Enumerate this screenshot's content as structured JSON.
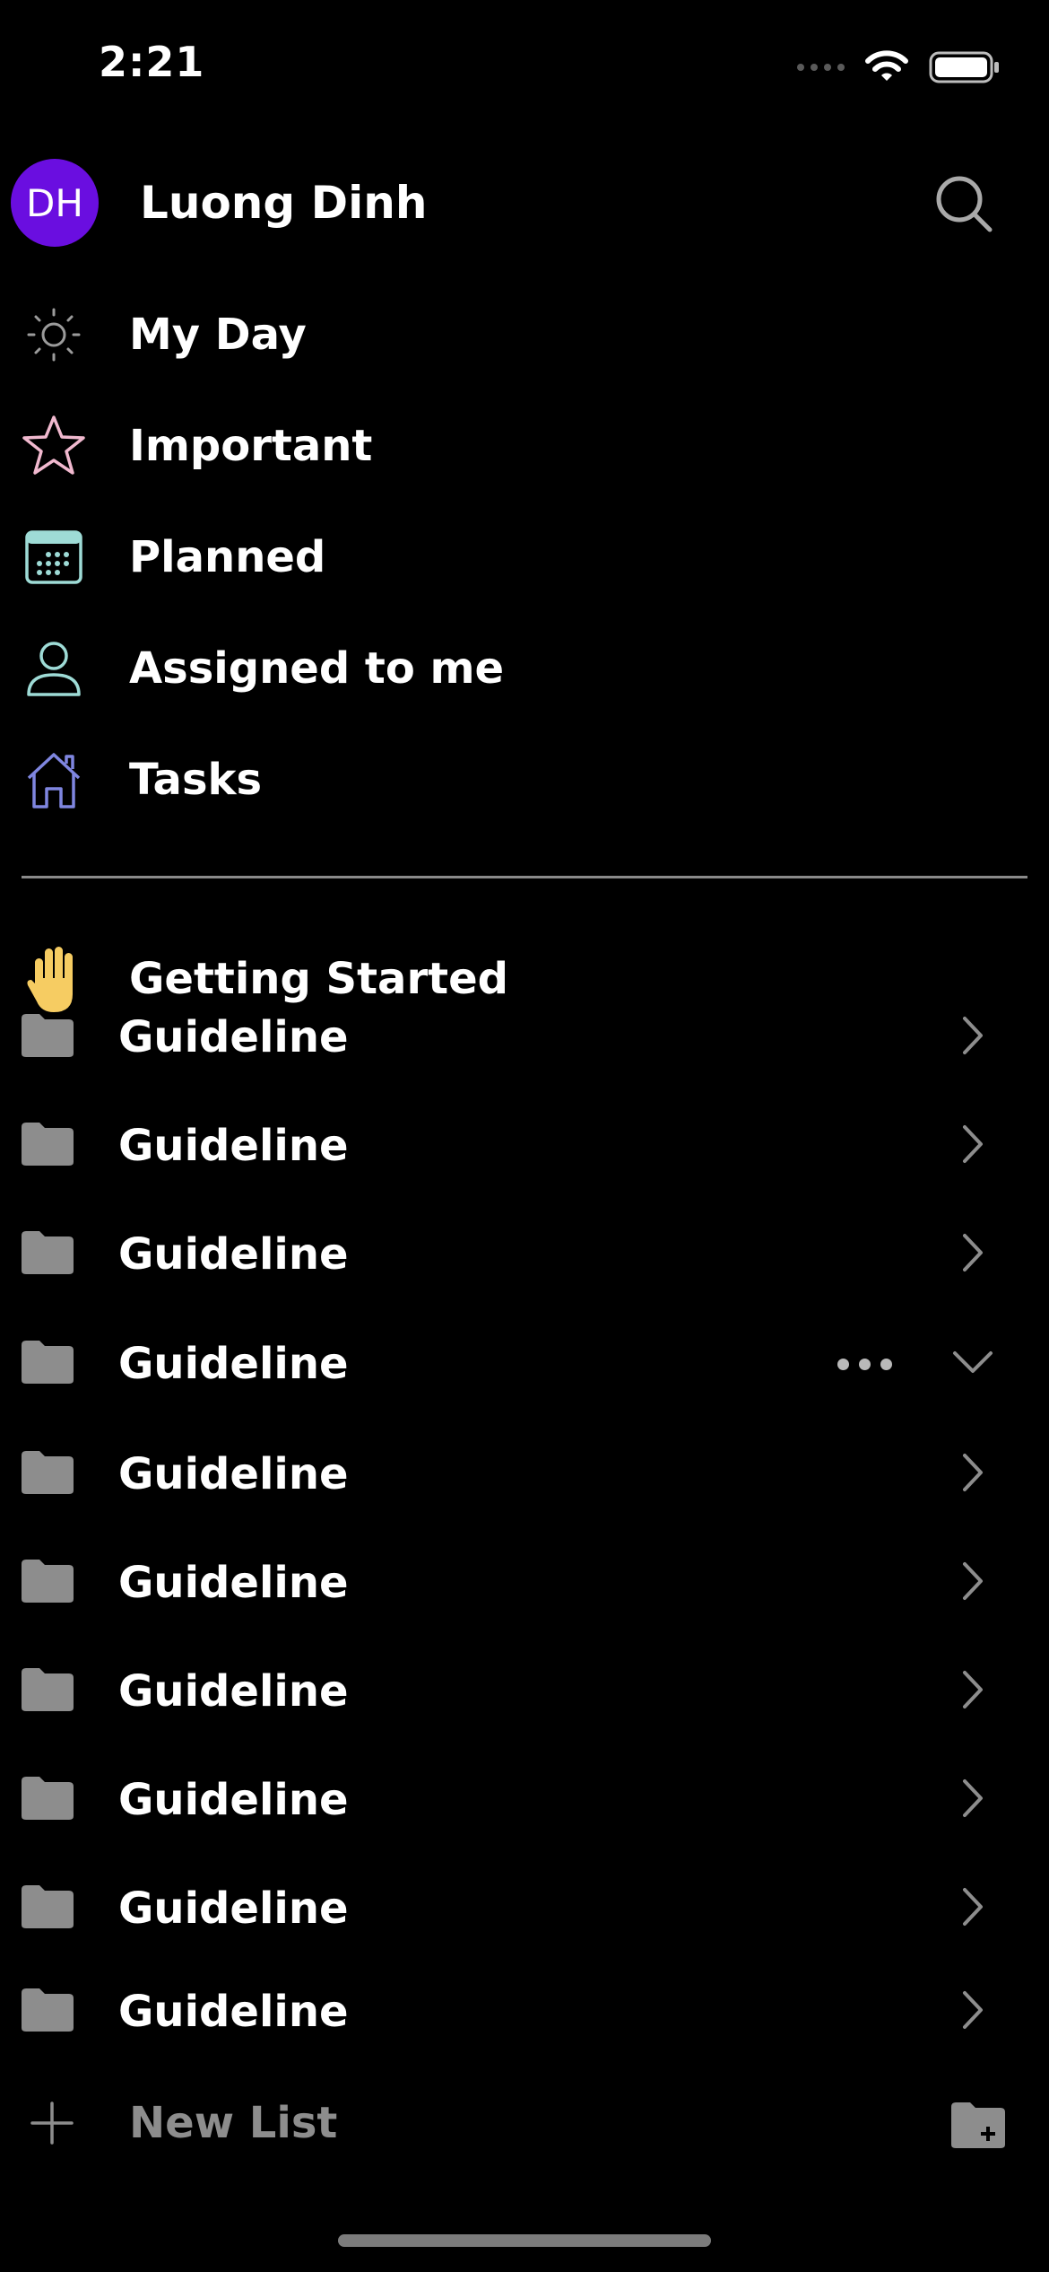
{
  "status_bar": {
    "time": "2:21",
    "icons": [
      "signal-dots-icon",
      "wifi-icon",
      "battery-icon"
    ]
  },
  "header": {
    "initials": "DH",
    "name": "Luong Dinh",
    "avatar_color": "#6a0ee0",
    "search_icon": "search-icon"
  },
  "smart_lists": [
    {
      "label": "My Day",
      "icon": "sun-icon",
      "color": "#9b9b9b"
    },
    {
      "label": "Important",
      "icon": "star-icon",
      "color": "#f1b9cf"
    },
    {
      "label": "Planned",
      "icon": "calendar-icon",
      "color": "#9edbd6"
    },
    {
      "label": "Assigned to me",
      "icon": "person-icon",
      "color": "#9edbd6"
    },
    {
      "label": "Tasks",
      "icon": "home-icon",
      "color": "#7f86e0"
    }
  ],
  "getting_started": {
    "label": "Getting Started",
    "icon": "raised-hand-icon"
  },
  "groups": [
    {
      "label": "Guideline",
      "state": "collapsed"
    },
    {
      "label": "Guideline",
      "state": "collapsed"
    },
    {
      "label": "Guideline",
      "state": "collapsed"
    },
    {
      "label": "Guideline",
      "state": "expanded"
    },
    {
      "label": "Guideline",
      "state": "collapsed"
    },
    {
      "label": "Guideline",
      "state": "collapsed"
    },
    {
      "label": "Guideline",
      "state": "collapsed"
    },
    {
      "label": "Guideline",
      "state": "collapsed"
    },
    {
      "label": "Guideline",
      "state": "collapsed"
    },
    {
      "label": "Guideline",
      "state": "collapsed"
    }
  ],
  "footer": {
    "new_list_label": "New List",
    "plus_icon": "plus-icon",
    "new_group_icon": "new-folder-icon"
  }
}
